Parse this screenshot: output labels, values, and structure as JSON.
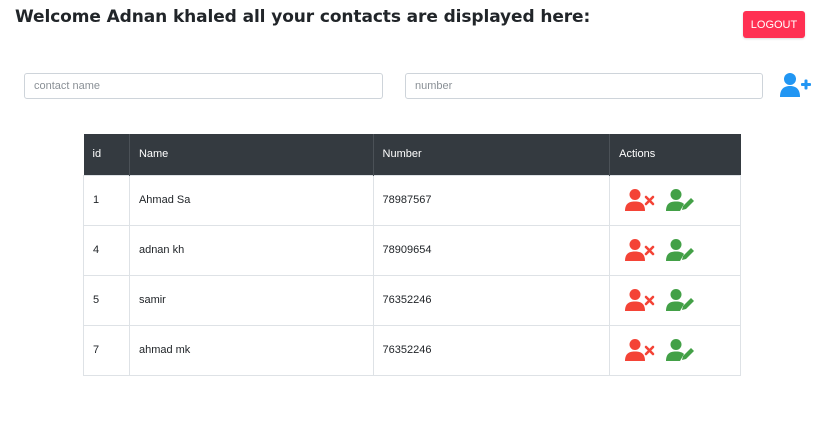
{
  "header": {
    "welcome_text": "Welcome Adnan khaled all your contacts are displayed here:",
    "logout_label": "LOGOUT"
  },
  "form": {
    "name_placeholder": "contact name",
    "number_placeholder": "number",
    "name_value": "",
    "number_value": "",
    "add_icon": "user-plus-icon"
  },
  "table": {
    "columns": [
      "id",
      "Name",
      "Number",
      "Actions"
    ],
    "rows": [
      {
        "id": "1",
        "name": "Ahmad Sa",
        "number": "78987567"
      },
      {
        "id": "4",
        "name": "adnan kh",
        "number": "78909654"
      },
      {
        "id": "5",
        "name": "samir",
        "number": "76352246"
      },
      {
        "id": "7",
        "name": "ahmad mk",
        "number": "76352246"
      }
    ],
    "actions": {
      "delete_icon": "user-times-icon",
      "edit_icon": "user-edit-icon"
    }
  },
  "colors": {
    "logout": "#ff3052",
    "header_bg": "#343a40",
    "delete": "#f44336",
    "edit": "#43a047",
    "add": "#2196f3"
  }
}
